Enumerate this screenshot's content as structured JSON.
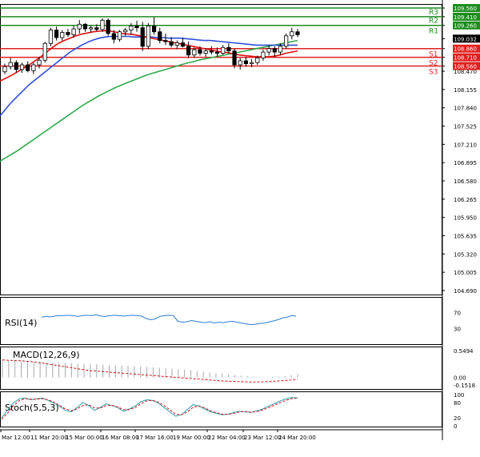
{
  "chart_data": {
    "type": "candlestick",
    "time_labels": [
      "Mar 12:00",
      "11 Mar 20:00",
      "15 Mar 00:00",
      "16 Mar 08:00",
      "17 Mar 16:00",
      "19 Mar 00:00",
      "22 Mar 04:00",
      "23 Mar 12:00",
      "24 Mar 20:00"
    ],
    "price_axis": {
      "min": 104.69,
      "max": 109.56,
      "tick_labels": [
        "109.560",
        "109.410",
        "109.260",
        "109.032",
        "108.860",
        "108.710",
        "108.560",
        "108.470",
        "108.155",
        "107.840",
        "107.525",
        "107.210",
        "106.895",
        "106.580",
        "106.265",
        "105.950",
        "105.635",
        "105.320",
        "105.005",
        "104.690"
      ]
    },
    "levels": [
      {
        "label": "R3",
        "value": 109.41,
        "color": "#1e8c1e"
      },
      {
        "label": "R2",
        "value": 109.26,
        "color": "#1e8c1e"
      },
      {
        "label": "R1",
        "value": 109.26,
        "color": "#1e8c1e"
      },
      {
        "label": "S1",
        "value": 108.86,
        "color": "#e02020"
      },
      {
        "label": "S2",
        "value": 108.71,
        "color": "#e02020"
      },
      {
        "label": "S3",
        "value": 108.56,
        "color": "#e02020"
      }
    ],
    "top_level": {
      "value": 109.56,
      "color": "#1e8c1e"
    },
    "current_price": 109.032,
    "candles": [
      [
        108.46,
        108.6,
        108.42,
        108.55
      ],
      [
        108.55,
        108.7,
        108.5,
        108.62
      ],
      [
        108.62,
        108.66,
        108.45,
        108.5
      ],
      [
        108.5,
        108.62,
        108.44,
        108.58
      ],
      [
        108.58,
        108.64,
        108.45,
        108.48
      ],
      [
        108.48,
        108.62,
        108.42,
        108.58
      ],
      [
        108.58,
        108.72,
        108.52,
        108.66
      ],
      [
        108.66,
        108.98,
        108.62,
        108.95
      ],
      [
        108.95,
        109.22,
        108.9,
        109.18
      ],
      [
        109.18,
        109.24,
        109.0,
        109.05
      ],
      [
        109.05,
        109.18,
        109.0,
        109.14
      ],
      [
        109.14,
        109.2,
        109.06,
        109.1
      ],
      [
        109.1,
        109.25,
        109.05,
        109.2
      ],
      [
        109.2,
        109.35,
        109.12,
        109.28
      ],
      [
        109.28,
        109.3,
        109.15,
        109.2
      ],
      [
        109.2,
        109.26,
        109.14,
        109.22
      ],
      [
        109.22,
        109.28,
        109.16,
        109.19
      ],
      [
        109.19,
        109.38,
        109.15,
        109.35
      ],
      [
        109.35,
        109.38,
        109.08,
        109.12
      ],
      [
        109.12,
        109.18,
        108.95,
        109.02
      ],
      [
        109.02,
        109.18,
        108.98,
        109.15
      ],
      [
        109.15,
        109.22,
        109.08,
        109.18
      ],
      [
        109.18,
        109.3,
        109.1,
        109.25
      ],
      [
        109.25,
        109.34,
        109.15,
        109.22
      ],
      [
        109.22,
        109.32,
        108.82,
        108.9
      ],
      [
        108.9,
        109.3,
        108.85,
        109.25
      ],
      [
        109.25,
        109.4,
        109.1,
        109.15
      ],
      [
        109.15,
        109.22,
        108.95,
        109.0
      ],
      [
        109.0,
        109.12,
        108.92,
        108.98
      ],
      [
        108.98,
        109.06,
        108.88,
        108.92
      ],
      [
        108.92,
        109.0,
        108.85,
        108.96
      ],
      [
        108.96,
        109.05,
        108.88,
        108.9
      ],
      [
        108.9,
        108.98,
        108.7,
        108.75
      ],
      [
        108.75,
        108.88,
        108.7,
        108.84
      ],
      [
        108.84,
        108.9,
        108.74,
        108.78
      ],
      [
        108.78,
        108.86,
        108.72,
        108.82
      ],
      [
        108.82,
        108.9,
        108.76,
        108.8
      ],
      [
        108.8,
        108.88,
        108.72,
        108.78
      ],
      [
        108.78,
        108.92,
        108.75,
        108.88
      ],
      [
        108.88,
        108.95,
        108.78,
        108.82
      ],
      [
        108.82,
        108.86,
        108.52,
        108.58
      ],
      [
        108.58,
        108.7,
        108.5,
        108.65
      ],
      [
        108.65,
        108.72,
        108.55,
        108.6
      ],
      [
        108.6,
        108.68,
        108.54,
        108.62
      ],
      [
        108.62,
        108.74,
        108.58,
        108.7
      ],
      [
        108.7,
        108.84,
        108.65,
        108.8
      ],
      [
        108.8,
        108.92,
        108.74,
        108.86
      ],
      [
        108.86,
        108.9,
        108.72,
        108.8
      ],
      [
        108.8,
        108.95,
        108.75,
        108.9
      ],
      [
        108.9,
        109.12,
        108.86,
        109.08
      ],
      [
        109.08,
        109.22,
        109.02,
        109.15
      ],
      [
        109.15,
        109.2,
        109.06,
        109.1
      ]
    ],
    "ma_fast": [
      108.3,
      108.35,
      108.4,
      108.46,
      108.52,
      108.58,
      108.65,
      108.72,
      108.8,
      108.88,
      108.95,
      109.0,
      109.04,
      109.08,
      109.11,
      109.13,
      109.15,
      109.16,
      109.17,
      109.16,
      109.14,
      109.12,
      109.11,
      109.1,
      109.08,
      109.06,
      109.04,
      109.02,
      109.0,
      108.98,
      108.96,
      108.94,
      108.92,
      108.9,
      108.88,
      108.86,
      108.84,
      108.82,
      108.8,
      108.79,
      108.77,
      108.75,
      108.74,
      108.73,
      108.72,
      108.72,
      108.72,
      108.73,
      108.75,
      108.78,
      108.8,
      108.82
    ],
    "ma_mid": [
      107.7,
      107.82,
      107.94,
      108.04,
      108.14,
      108.24,
      108.32,
      108.4,
      108.48,
      108.56,
      108.64,
      108.72,
      108.8,
      108.86,
      108.92,
      108.97,
      109.01,
      109.04,
      109.06,
      109.07,
      109.07,
      109.07,
      109.07,
      109.06,
      109.06,
      109.06,
      109.06,
      109.05,
      109.05,
      109.04,
      109.04,
      109.04,
      109.03,
      109.02,
      109.01,
      109.0,
      109.0,
      108.99,
      108.98,
      108.97,
      108.96,
      108.95,
      108.94,
      108.93,
      108.92,
      108.92,
      108.92,
      108.92,
      108.92,
      108.92,
      108.92,
      108.92
    ],
    "ma_slow": [
      106.92,
      106.98,
      107.04,
      107.1,
      107.17,
      107.24,
      107.31,
      107.38,
      107.45,
      107.52,
      107.59,
      107.66,
      107.73,
      107.8,
      107.87,
      107.93,
      107.99,
      108.05,
      108.1,
      108.15,
      108.2,
      108.24,
      108.28,
      108.32,
      108.36,
      108.4,
      108.43,
      108.46,
      108.49,
      108.52,
      108.55,
      108.58,
      108.61,
      108.63,
      108.66,
      108.68,
      108.7,
      108.72,
      108.74,
      108.76,
      108.78,
      108.8,
      108.82,
      108.84,
      108.86,
      108.88,
      108.9,
      108.92,
      108.94,
      108.96,
      108.98,
      109.0
    ],
    "rsi": {
      "label": "RSI(14)",
      "axis_labels": [
        "70",
        "30"
      ],
      "values": [
        58,
        60,
        59,
        61,
        62,
        62,
        63,
        62,
        60,
        62,
        63,
        62,
        64,
        61,
        60,
        62,
        63,
        62,
        61,
        62,
        63,
        62,
        61,
        55,
        52,
        54,
        60,
        62,
        63,
        62,
        48,
        46,
        47,
        50,
        48,
        46,
        45,
        47,
        44,
        46,
        45,
        47,
        48,
        46,
        44,
        42,
        40,
        41,
        43,
        44,
        46,
        49,
        52,
        56,
        58,
        62,
        61
      ]
    },
    "macd": {
      "label": "MACD(12,26,9)",
      "axis_labels": [
        "0.5494",
        "0.00",
        "-0.1518"
      ],
      "histogram": [
        0.35,
        0.34,
        0.34,
        0.33,
        0.33,
        0.32,
        0.32,
        0.31,
        0.31,
        0.3,
        0.29,
        0.29,
        0.28,
        0.28,
        0.27,
        0.27,
        0.26,
        0.25,
        0.25,
        0.24,
        0.24,
        0.23,
        0.22,
        0.22,
        0.21,
        0.2,
        0.19,
        0.18,
        0.17,
        0.16,
        0.15,
        0.13,
        0.12,
        0.1,
        0.09,
        0.08,
        0.06,
        0.05,
        0.04,
        0.03,
        0.02,
        0.01,
        0.005,
        0.01,
        0.02,
        0.03,
        0.05,
        0.07
      ],
      "signal": [
        0.36,
        0.35,
        0.345,
        0.34,
        0.33,
        0.32,
        0.3,
        0.28,
        0.26,
        0.24,
        0.22,
        0.2,
        0.18,
        0.16,
        0.14,
        0.13,
        0.12,
        0.11,
        0.1,
        0.09,
        0.08,
        0.07,
        0.06,
        0.05,
        0.04,
        0.03,
        0.02,
        0.01,
        0.0,
        -0.01,
        -0.02,
        -0.03,
        -0.04,
        -0.05,
        -0.06,
        -0.07,
        -0.075,
        -0.08,
        -0.085,
        -0.09,
        -0.09,
        -0.09,
        -0.085,
        -0.08,
        -0.07,
        -0.06,
        -0.05,
        -0.03
      ]
    },
    "stoch": {
      "label": "Stoch(5,5,3)",
      "axis_labels": [
        "100",
        "80",
        "20",
        "0"
      ],
      "k": [
        20,
        45,
        70,
        85,
        88,
        82,
        85,
        88,
        80,
        70,
        60,
        45,
        40,
        55,
        72,
        62,
        45,
        55,
        68,
        62,
        55,
        42,
        50,
        60,
        75,
        82,
        80,
        70,
        55,
        40,
        25,
        30,
        48,
        65,
        60,
        50,
        40,
        35,
        30,
        32,
        38,
        42,
        40,
        38,
        44,
        50,
        60,
        68,
        78,
        85,
        90,
        88
      ],
      "d": [
        15,
        35,
        60,
        78,
        86,
        84,
        84,
        86,
        82,
        74,
        62,
        50,
        44,
        50,
        62,
        65,
        54,
        53,
        62,
        63,
        57,
        48,
        48,
        55,
        68,
        78,
        80,
        74,
        62,
        47,
        32,
        30,
        40,
        56,
        60,
        54,
        44,
        37,
        32,
        31,
        35,
        40,
        41,
        39,
        41,
        47,
        55,
        63,
        72,
        80,
        86,
        88
      ]
    }
  }
}
